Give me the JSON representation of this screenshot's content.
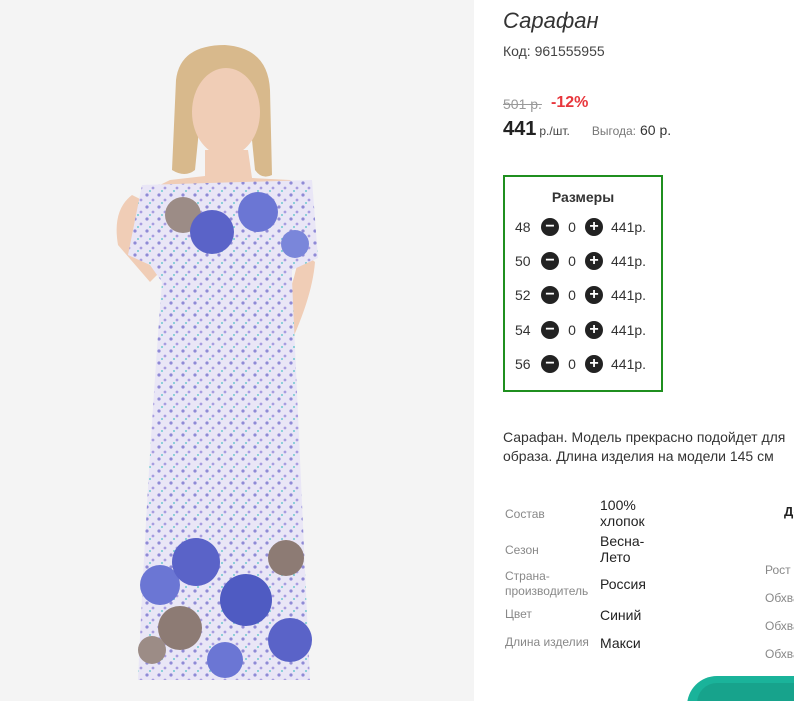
{
  "product": {
    "title": "Сарафан",
    "code": "Код: 961555955",
    "old_price": "501 р.",
    "discount": "-12%",
    "price": "441",
    "unit": "р./шт.",
    "benefit_label": "Выгода:",
    "benefit_value": "60 р."
  },
  "sizes": {
    "title": "Размеры",
    "minus_symbol": "−",
    "plus_symbol": "+",
    "rows": [
      {
        "size": "48",
        "qty": "0",
        "price": "441р."
      },
      {
        "size": "50",
        "qty": "0",
        "price": "441р."
      },
      {
        "size": "52",
        "qty": "0",
        "price": "441р."
      },
      {
        "size": "54",
        "qty": "0",
        "price": "441р."
      },
      {
        "size": "56",
        "qty": "0",
        "price": "441р."
      }
    ]
  },
  "description": "Сарафан. Модель прекрасно подойдет для образа. Длина изделия на модели 145 см",
  "properties": [
    {
      "label": "Состав",
      "value": "100% хлопок"
    },
    {
      "label": "Сезон",
      "value": "Весна-Лето"
    },
    {
      "label": "Страна-производитель",
      "value": "Россия"
    },
    {
      "label": "Цвет",
      "value": "Синий"
    },
    {
      "label": "Длина изделия",
      "value": "Макси"
    }
  ],
  "column2": {
    "header_fragment": "До",
    "labels": [
      "Рост",
      "Обхва",
      "Обхва",
      "Обхва"
    ]
  },
  "colors": {
    "accent_green": "#1f8f1f",
    "discount_red": "#e8363c",
    "teal": "#1ab39a"
  },
  "icons": {
    "minus": "minus-circle-icon",
    "plus": "plus-circle-icon"
  }
}
